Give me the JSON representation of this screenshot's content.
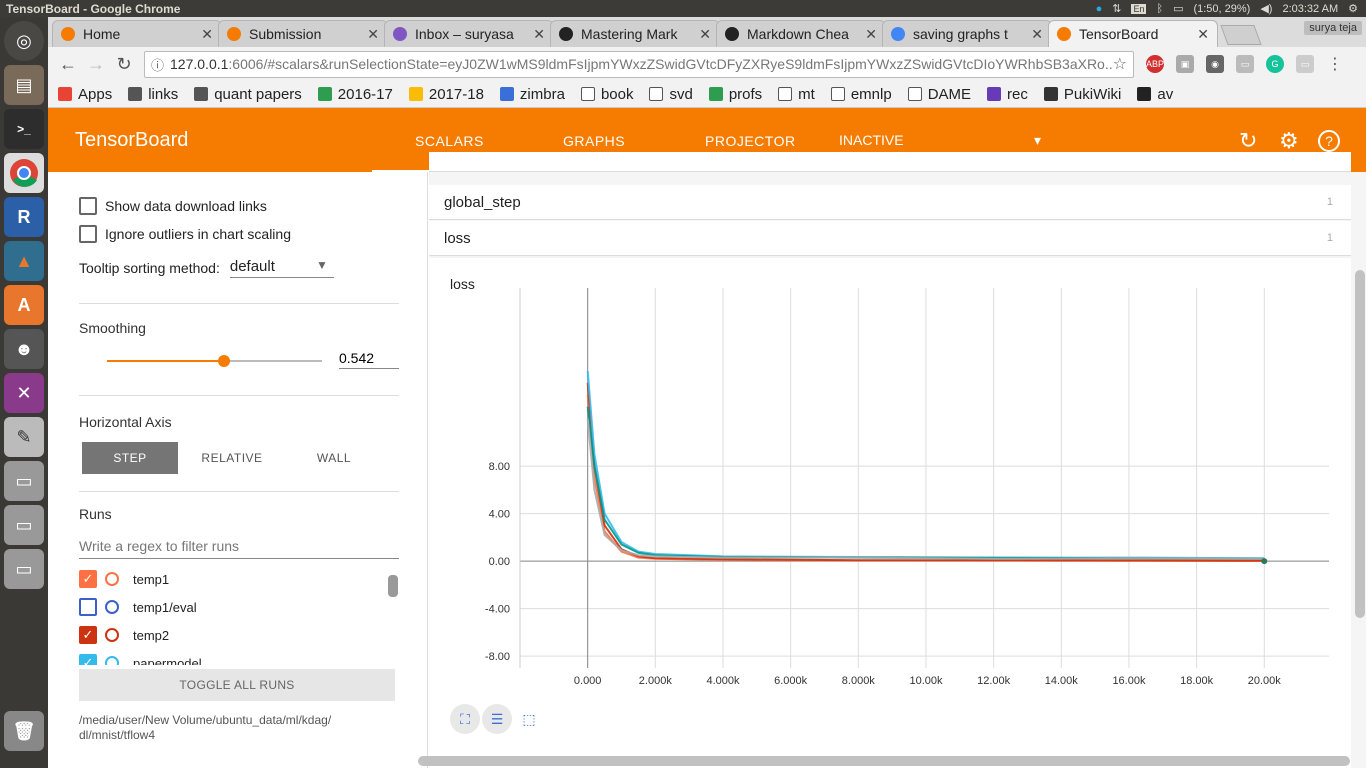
{
  "os_bar": {
    "window_title": "TensorBoard - Google Chrome",
    "battery": "(1:50, 29%)",
    "clock": "2:03:32 AM",
    "lang": "En"
  },
  "browser": {
    "tabs": [
      {
        "label": "Home",
        "color": "#f57c00"
      },
      {
        "label": "Submission",
        "color": "#f57c00"
      },
      {
        "label": "Inbox – suryasa",
        "color": "#7e57c2"
      },
      {
        "label": "Mastering Mark",
        "color": "#222222"
      },
      {
        "label": "Markdown Chea",
        "color": "#222222"
      },
      {
        "label": "saving graphs t",
        "color": "#4285f4"
      },
      {
        "label": "TensorBoard",
        "color": "#f57c00"
      }
    ],
    "profile": "surya teja",
    "url_host": "127.0.0.1",
    "url_rest": ":6006/#scalars&runSelectionState=eyJ0ZW1wMS9ldmFsIjpmYWxzZSwidGVtcDFyZXRyeS9ldmFsIjpmYWxzZSwidGVtcDIoYWRhbSB3aXRo...",
    "bookmarks": [
      "Apps",
      "links",
      "quant papers",
      "2016-17",
      "2017-18",
      "zimbra",
      "book",
      "svd",
      "profs",
      "mt",
      "emnlp",
      "DAME",
      "rec",
      "PukiWiki",
      "av"
    ]
  },
  "tb": {
    "brand": "TensorBoard",
    "nav": [
      "SCALARS",
      "GRAPHS",
      "PROJECTOR"
    ],
    "inactive": "INACTIVE",
    "sidebar": {
      "show_download": "Show data download links",
      "ignore_outliers": "Ignore outliers in chart scaling",
      "tooltip_label": "Tooltip sorting method:",
      "tooltip_value": "default",
      "smoothing_title": "Smoothing",
      "smoothing_value": "0.542",
      "smoothing_level": 0.542,
      "haxis_title": "Horizontal Axis",
      "haxis_options": [
        "STEP",
        "RELATIVE",
        "WALL"
      ],
      "runs_title": "Runs",
      "runs_placeholder": "Write a regex to filter runs",
      "runs": [
        {
          "name": "temp1",
          "checked": true,
          "color": "#ff7043"
        },
        {
          "name": "temp1/eval",
          "checked": false,
          "color": "#3b5fcc"
        },
        {
          "name": "temp2",
          "checked": true,
          "color": "#cc3311"
        },
        {
          "name": "papermodel",
          "checked": true,
          "color": "#33bbee"
        }
      ],
      "toggle_all": "TOGGLE ALL RUNS",
      "logdir": "/media/user/New Volume/ubuntu_data/ml/kdag/\ndl/mnist/tflow4"
    },
    "tags": [
      {
        "name": "global_step",
        "count": "1"
      },
      {
        "name": "loss",
        "count": "1"
      }
    ]
  },
  "chart_data": {
    "type": "line",
    "title": "loss",
    "xlabel": "",
    "ylabel": "",
    "xlim": [
      -2000,
      20000
    ],
    "ylim": [
      -9,
      23
    ],
    "x_ticks": [
      "0.000",
      "2.000k",
      "4.000k",
      "6.000k",
      "8.000k",
      "10.00k",
      "12.00k",
      "14.00k",
      "16.00k",
      "18.00k",
      "20.00k"
    ],
    "y_ticks": [
      "8.00",
      "4.00",
      "0.00",
      "-4.00",
      "-8.00"
    ],
    "series": [
      {
        "color": "#ff7043",
        "x": [
          0,
          200,
          500,
          1000,
          1500,
          2000,
          4000,
          8000,
          12000,
          16000,
          20000
        ],
        "y": [
          14,
          7,
          2.5,
          0.8,
          0.3,
          0.2,
          0.1,
          0.05,
          0.05,
          0.03,
          0.02
        ]
      },
      {
        "color": "#cc3311",
        "x": [
          0,
          200,
          500,
          1000,
          1500,
          2000,
          4000,
          8000,
          12000,
          16000,
          20000
        ],
        "y": [
          15,
          8,
          3,
          1.0,
          0.4,
          0.25,
          0.15,
          0.08,
          0.06,
          0.05,
          0.04
        ]
      },
      {
        "color": "#33bbee",
        "x": [
          0,
          200,
          500,
          1000,
          1500,
          2000,
          4000,
          8000,
          12000,
          16000,
          20000
        ],
        "y": [
          16,
          9,
          4,
          1.6,
          0.8,
          0.6,
          0.4,
          0.35,
          0.3,
          0.3,
          0.25
        ]
      },
      {
        "color": "#009988",
        "x": [
          0,
          200,
          500,
          1000,
          1500,
          2000,
          4000,
          8000,
          12000,
          16000,
          20000
        ],
        "y": [
          13,
          8,
          3.5,
          1.4,
          0.7,
          0.5,
          0.35,
          0.3,
          0.28,
          0.25,
          0.2
        ]
      },
      {
        "color": "#aaaaaa",
        "x": [
          0,
          200,
          500,
          1000,
          1500,
          2000,
          4000,
          8000,
          12000,
          16000,
          20000
        ],
        "y": [
          12,
          6,
          2.2,
          0.9,
          0.5,
          0.4,
          0.3,
          0.3,
          0.2,
          0.25,
          0.2
        ]
      }
    ]
  }
}
